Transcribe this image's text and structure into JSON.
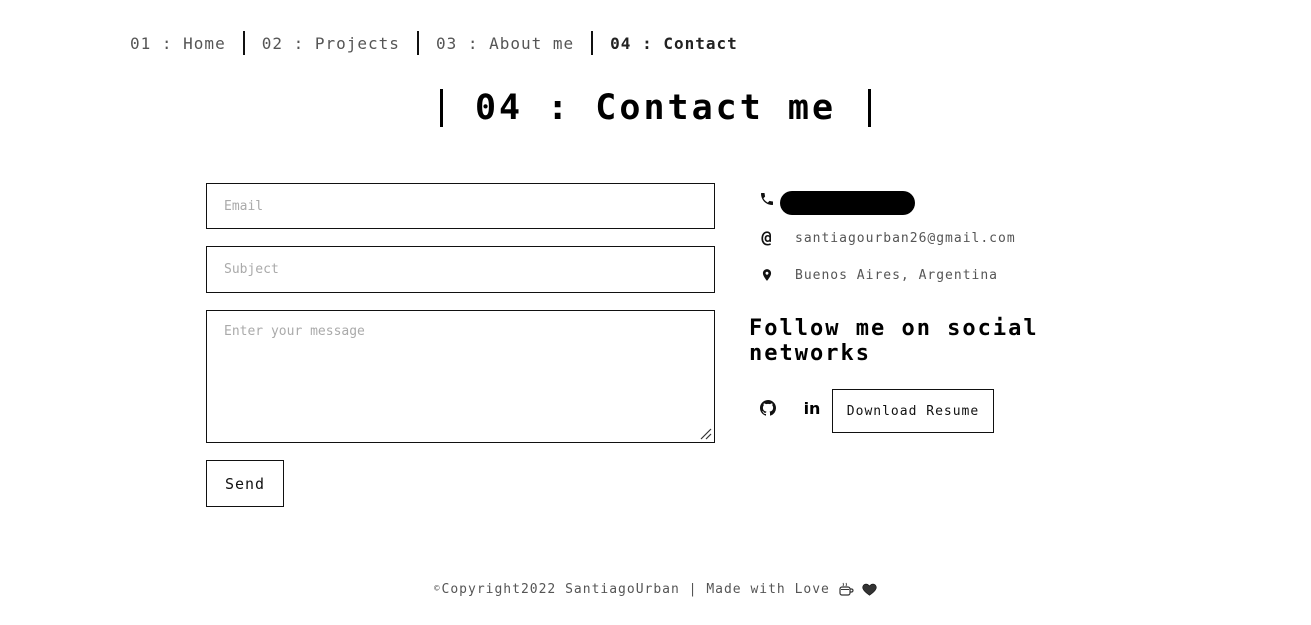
{
  "nav": {
    "items": [
      {
        "label": "01 : Home",
        "active": false
      },
      {
        "label": "02 : Projects",
        "active": false
      },
      {
        "label": "03 : About me",
        "active": false
      },
      {
        "label": "04 : Contact",
        "active": true
      }
    ]
  },
  "title": "04 : Contact me",
  "form": {
    "email_placeholder": "Email",
    "subject_placeholder": "Subject",
    "message_placeholder": "Enter your message",
    "send_label": "Send"
  },
  "contact": {
    "email": "santiagourban26@gmail.com",
    "location": "Buenos Aires, Argentina",
    "at_symbol": "@"
  },
  "social": {
    "heading": "Follow me on social networks",
    "linkedin_label": "in",
    "resume_label": "Download Resume"
  },
  "footer": {
    "copyright_symbol": "©",
    "text": "Copyright2022 SantiagoUrban | Made with Love"
  },
  "icons": {
    "phone": "phone-icon",
    "email": "at-icon",
    "location": "map-pin-icon",
    "github": "github-icon",
    "linkedin": "linkedin-icon",
    "coffee": "coffee-icon",
    "heart": "heart-icon"
  }
}
